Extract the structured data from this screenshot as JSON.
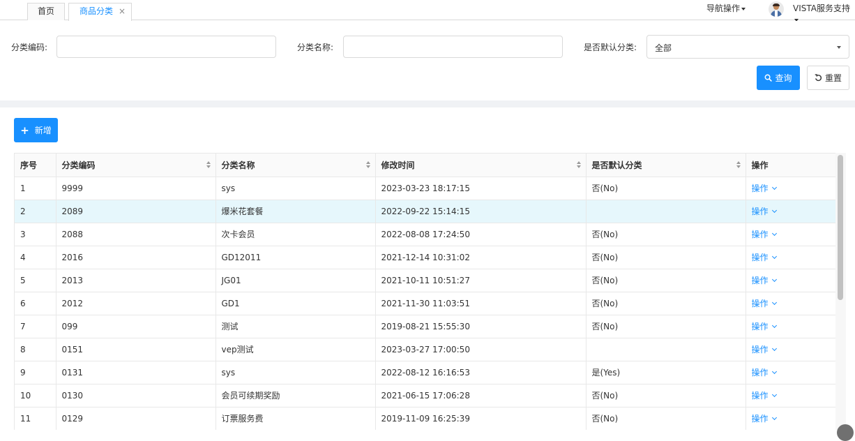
{
  "tabs": [
    {
      "label": "首页"
    },
    {
      "label": "商品分类",
      "close": "×"
    }
  ],
  "header": {
    "nav_ops": "导航操作",
    "user": "VISTA服务支持"
  },
  "filters": {
    "code_label": "分类编码:",
    "code_value": "",
    "name_label": "分类名称:",
    "name_value": "",
    "default_label": "是否默认分类:",
    "default_value": "全部",
    "query_button": "查询",
    "reset_button": "重置"
  },
  "toolbar": {
    "add_button": "新增"
  },
  "table": {
    "columns": [
      "序号",
      "分类编码",
      "分类名称",
      "修改时间",
      "是否默认分类",
      "操作"
    ],
    "op_label": "操作",
    "rows": [
      {
        "idx": "1",
        "code": "9999",
        "name": "sys",
        "time": "2023-03-23 18:17:15",
        "is_default": "否(No)"
      },
      {
        "idx": "2",
        "code": "2089",
        "name": "爆米花套餐",
        "time": "2022-09-22 15:14:15",
        "is_default": ""
      },
      {
        "idx": "3",
        "code": "2088",
        "name": "次卡会员",
        "time": "2022-08-08 17:24:50",
        "is_default": "否(No)"
      },
      {
        "idx": "4",
        "code": "2016",
        "name": "GD12011",
        "time": "2021-12-14 10:31:02",
        "is_default": "否(No)"
      },
      {
        "idx": "5",
        "code": "2013",
        "name": "JG01",
        "time": "2021-10-11 10:51:27",
        "is_default": "否(No)"
      },
      {
        "idx": "6",
        "code": "2012",
        "name": "GD1",
        "time": "2021-11-30 11:03:51",
        "is_default": "否(No)"
      },
      {
        "idx": "7",
        "code": "099",
        "name": "测试",
        "time": "2019-08-21 15:55:30",
        "is_default": "否(No)"
      },
      {
        "idx": "8",
        "code": "0151",
        "name": "vep测试",
        "time": "2023-03-27 17:00:50",
        "is_default": ""
      },
      {
        "idx": "9",
        "code": "0131",
        "name": "sys",
        "time": "2022-08-12 16:16:53",
        "is_default": "是(Yes)"
      },
      {
        "idx": "10",
        "code": "0130",
        "name": "会员可续期奖励",
        "time": "2021-06-15 17:06:28",
        "is_default": "否(No)"
      },
      {
        "idx": "11",
        "code": "0129",
        "name": "订票服务费",
        "time": "2019-11-09 16:25:39",
        "is_default": "否(No)"
      }
    ]
  },
  "colors": {
    "primary": "#1890ff",
    "highlight_row": "#e6f7fc",
    "page_gap": "#f0f2f5"
  }
}
